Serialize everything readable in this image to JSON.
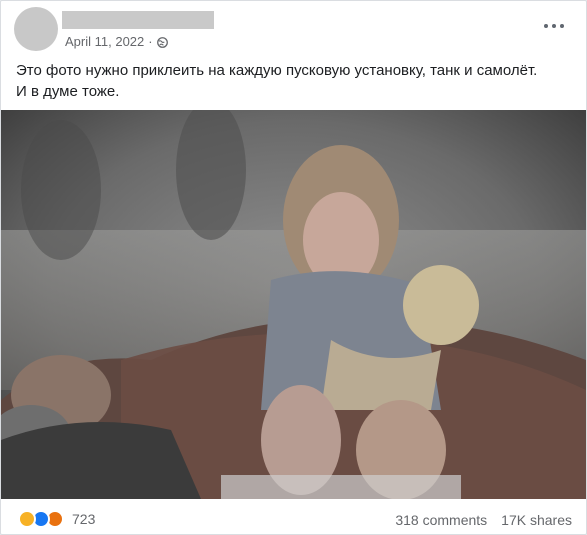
{
  "post": {
    "date": "April 11, 2022",
    "separator": "·",
    "audience_icon": "globe-icon",
    "more_icon": "more-options-icon",
    "text_lines": [
      "Это фото нужно приклеить на каждую пусковую установку, танк и самолёт.",
      "И в думе тоже."
    ]
  },
  "reactions": {
    "icons": [
      "sad-reaction-icon",
      "like-reaction-icon",
      "angry-reaction-icon"
    ],
    "count": "723"
  },
  "engagement": {
    "comments": "318 comments",
    "shares": "17K shares"
  },
  "colors": {
    "text": "#1c1e21",
    "secondary": "#65676b",
    "like": "#1877f2",
    "sad": "#f7b125",
    "angry": "#e9710f"
  }
}
